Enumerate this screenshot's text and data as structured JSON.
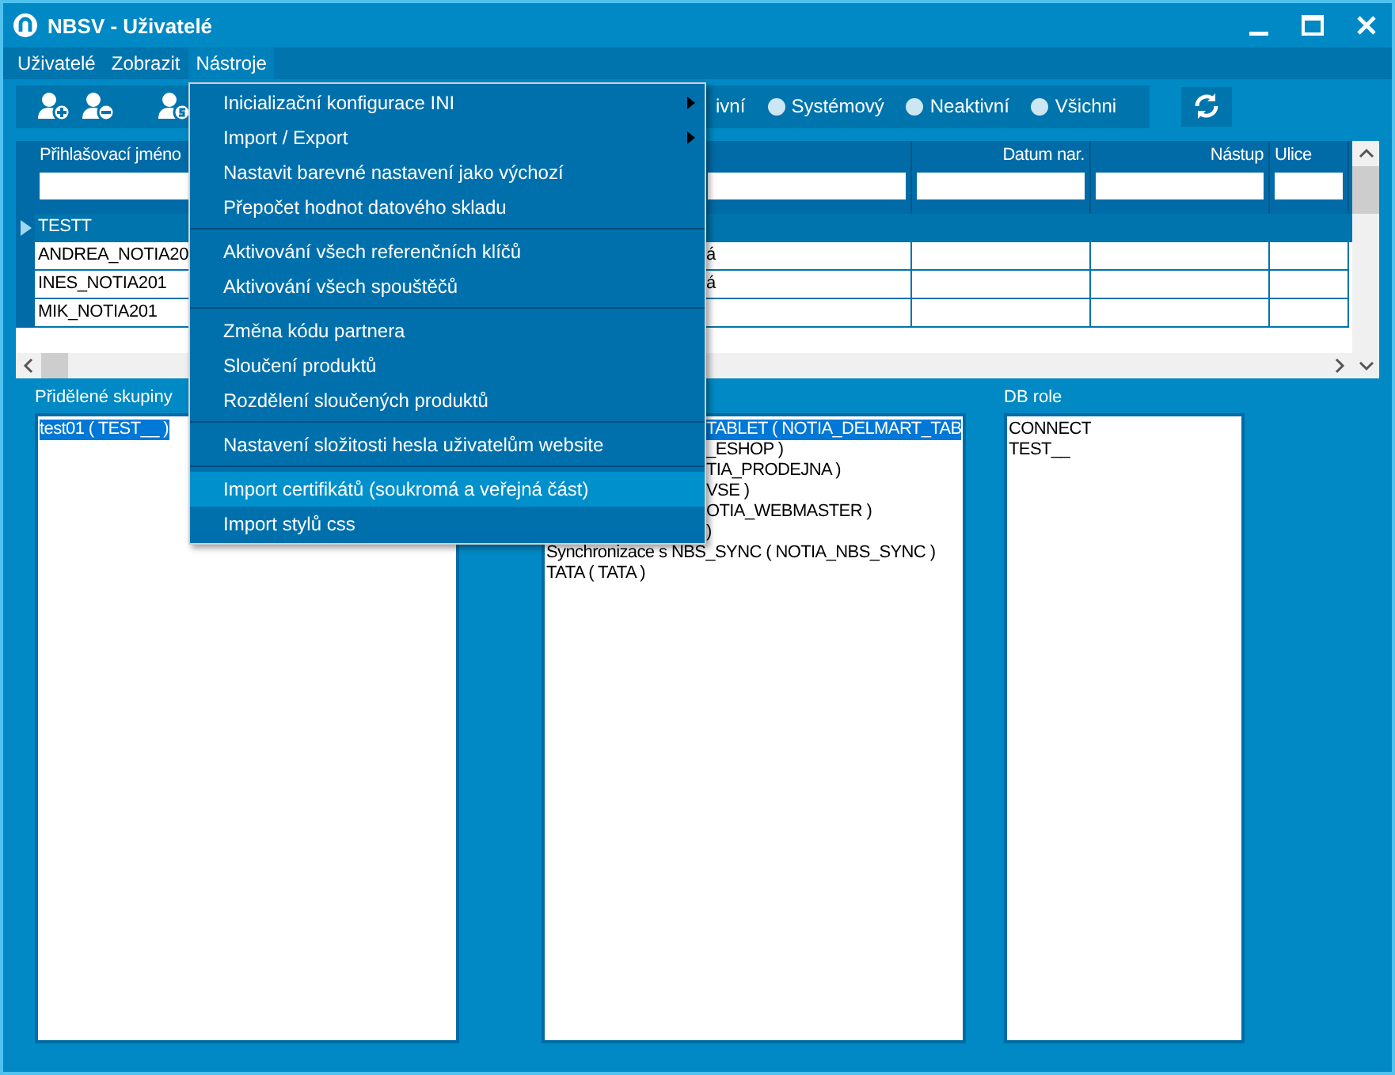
{
  "window": {
    "title": "NBSV - Uživatelé"
  },
  "menu_bar": [
    {
      "label": "Uživatelé",
      "selected": false
    },
    {
      "label": "Zobrazit",
      "selected": false
    },
    {
      "label": "Nástroje",
      "selected": true
    }
  ],
  "dropdown_menu": [
    {
      "kind": "item",
      "label": "Inicializační konfigurace INI",
      "submenu": true,
      "selected": false
    },
    {
      "kind": "item",
      "label": "Import / Export",
      "submenu": true,
      "selected": false
    },
    {
      "kind": "item",
      "label": "Nastavit barevné nastavení jako výchozí",
      "submenu": false,
      "selected": false
    },
    {
      "kind": "item",
      "label": "Přepočet hodnot datového skladu",
      "submenu": false,
      "selected": false
    },
    {
      "kind": "separator"
    },
    {
      "kind": "item",
      "label": "Aktivování všech referenčních klíčů",
      "submenu": false,
      "selected": false
    },
    {
      "kind": "item",
      "label": "Aktivování všech spouštěčů",
      "submenu": false,
      "selected": false
    },
    {
      "kind": "separator"
    },
    {
      "kind": "item",
      "label": "Změna kódu partnera",
      "submenu": false,
      "selected": false
    },
    {
      "kind": "item",
      "label": "Sloučení produktů",
      "submenu": false,
      "selected": false
    },
    {
      "kind": "item",
      "label": "Rozdělení sloučených produktů",
      "submenu": false,
      "selected": false
    },
    {
      "kind": "separator"
    },
    {
      "kind": "item",
      "label": "Nastavení složitosti hesla uživatelům website",
      "submenu": false,
      "selected": false
    },
    {
      "kind": "separator"
    },
    {
      "kind": "item",
      "label": "Import certifikátů (soukromá a veřejná část)",
      "submenu": false,
      "selected": true
    },
    {
      "kind": "item",
      "label": "Import stylů css",
      "submenu": false,
      "selected": false
    }
  ],
  "toolbar": {
    "filters": [
      {
        "label": "ivní",
        "kind": "covered",
        "selected": false
      },
      {
        "label": "Systémový",
        "kind": "full",
        "selected": false
      },
      {
        "label": "Neaktivní",
        "kind": "full",
        "selected": false
      },
      {
        "label": "Všichni",
        "kind": "full",
        "selected": false
      }
    ]
  },
  "table": {
    "columns": [
      {
        "label": "Přihlašovací jméno"
      },
      {},
      {
        "label": "Datum nar."
      },
      {
        "label": "Nástup"
      },
      {
        "label": "Ulice"
      }
    ],
    "rows": [
      {
        "selected": true,
        "cells": [
          "TESTT",
          "",
          "",
          "",
          ""
        ]
      },
      {
        "selected": false,
        "cells": [
          "ANDREA_NOTIA20",
          "á",
          "",
          "",
          ""
        ]
      },
      {
        "selected": false,
        "cells": [
          "INES_NOTIA201",
          "á",
          "",
          "",
          ""
        ]
      },
      {
        "selected": false,
        "cells": [
          "MIK_NOTIA201",
          "",
          "",
          "",
          ""
        ]
      }
    ]
  },
  "panels": [
    {
      "label": "Přidělené skupiny",
      "items": [
        {
          "text": "test01 ( TEST__ )",
          "kind": "full",
          "selected": true
        }
      ]
    },
    {
      "items": [
        {
          "text": "TABLET ( NOTIA_DELMART_TAB",
          "kind": "covered",
          "selected": true
        },
        {
          "text": "_ESHOP )",
          "kind": "covered",
          "selected": false
        },
        {
          "text": "TIA_PRODEJNA )",
          "kind": "covered",
          "selected": false
        },
        {
          "text": "VSE )",
          "kind": "covered",
          "selected": false
        },
        {
          "text": "OTIA_WEBMASTER )",
          "kind": "covered",
          "selected": false
        },
        {
          "text": ")",
          "kind": "covered",
          "selected": false
        },
        {
          "text": "Synchronizace s NBS_SYNC ( NOTIA_NBS_SYNC )",
          "kind": "full",
          "selected": false
        },
        {
          "text": "TATA ( TATA )",
          "kind": "full",
          "selected": false
        }
      ]
    },
    {
      "label": "DB role",
      "items": [
        {
          "text": "CONNECT",
          "kind": "full",
          "selected": false
        },
        {
          "text": "TEST__",
          "kind": "full",
          "selected": false
        }
      ]
    }
  ]
}
